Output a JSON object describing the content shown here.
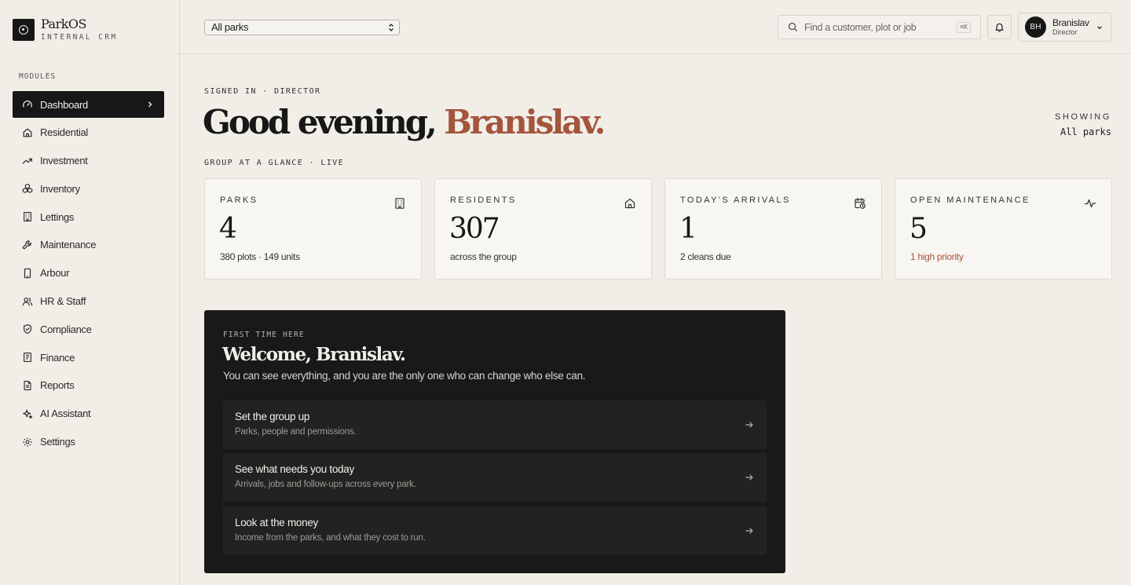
{
  "brand": {
    "name": "ParkOS",
    "subtitle": "INTERNAL CRM"
  },
  "sidebar": {
    "section_label": "MODULES",
    "items": [
      {
        "label": "Dashboard",
        "icon": "gauge-icon",
        "active": true
      },
      {
        "label": "Residential",
        "icon": "home-icon"
      },
      {
        "label": "Investment",
        "icon": "trending-up-icon"
      },
      {
        "label": "Inventory",
        "icon": "boxes-icon"
      },
      {
        "label": "Lettings",
        "icon": "building-icon"
      },
      {
        "label": "Maintenance",
        "icon": "wrench-icon"
      },
      {
        "label": "Arbour",
        "icon": "phone-icon"
      },
      {
        "label": "HR & Staff",
        "icon": "users-icon"
      },
      {
        "label": "Compliance",
        "icon": "shield-check-icon"
      },
      {
        "label": "Finance",
        "icon": "receipt-icon"
      },
      {
        "label": "Reports",
        "icon": "file-text-icon"
      },
      {
        "label": "AI Assistant",
        "icon": "sparkles-icon"
      },
      {
        "label": "Settings",
        "icon": "gear-icon"
      }
    ]
  },
  "topbar": {
    "park_select": "All parks",
    "search_placeholder": "Find a customer, plot or job",
    "search_shortcut": "⌘K",
    "user": {
      "initials": "BH",
      "name": "Branislav",
      "role": "Director"
    }
  },
  "main": {
    "eyebrow": "SIGNED IN · DIRECTOR",
    "greeting_prefix": "Good evening,",
    "greeting_name": "Branislav.",
    "showing_label": "SHOWING",
    "showing_value": "All parks",
    "glance_label": "GROUP AT A GLANCE · LIVE",
    "cards": [
      {
        "label": "PARKS",
        "value": "4",
        "sub": "380 plots · 149 units",
        "icon": "building-icon"
      },
      {
        "label": "RESIDENTS",
        "value": "307",
        "sub": "across the group",
        "icon": "home-icon"
      },
      {
        "label": "TODAY'S ARRIVALS",
        "value": "1",
        "sub": "2 cleans due",
        "icon": "calendar-clock-icon"
      },
      {
        "label": "OPEN MAINTENANCE",
        "value": "5",
        "sub": "1 high priority",
        "icon": "activity-icon",
        "sub_color": "#a4553c"
      }
    ],
    "welcome": {
      "eyebrow": "FIRST TIME HERE",
      "title": "Welcome, Branislav.",
      "description": "You can see everything, and you are the only one who can change who else can.",
      "items": [
        {
          "title": "Set the group up",
          "subtitle": "Parks, people and permissions."
        },
        {
          "title": "See what needs you today",
          "subtitle": "Arrivals, jobs and follow-ups across every park."
        },
        {
          "title": "Look at the money",
          "subtitle": "Income from the parks, and what they cost to run."
        }
      ]
    }
  },
  "colors": {
    "accent": "#a4553c",
    "dark": "#161716",
    "background": "#f1eee8"
  }
}
